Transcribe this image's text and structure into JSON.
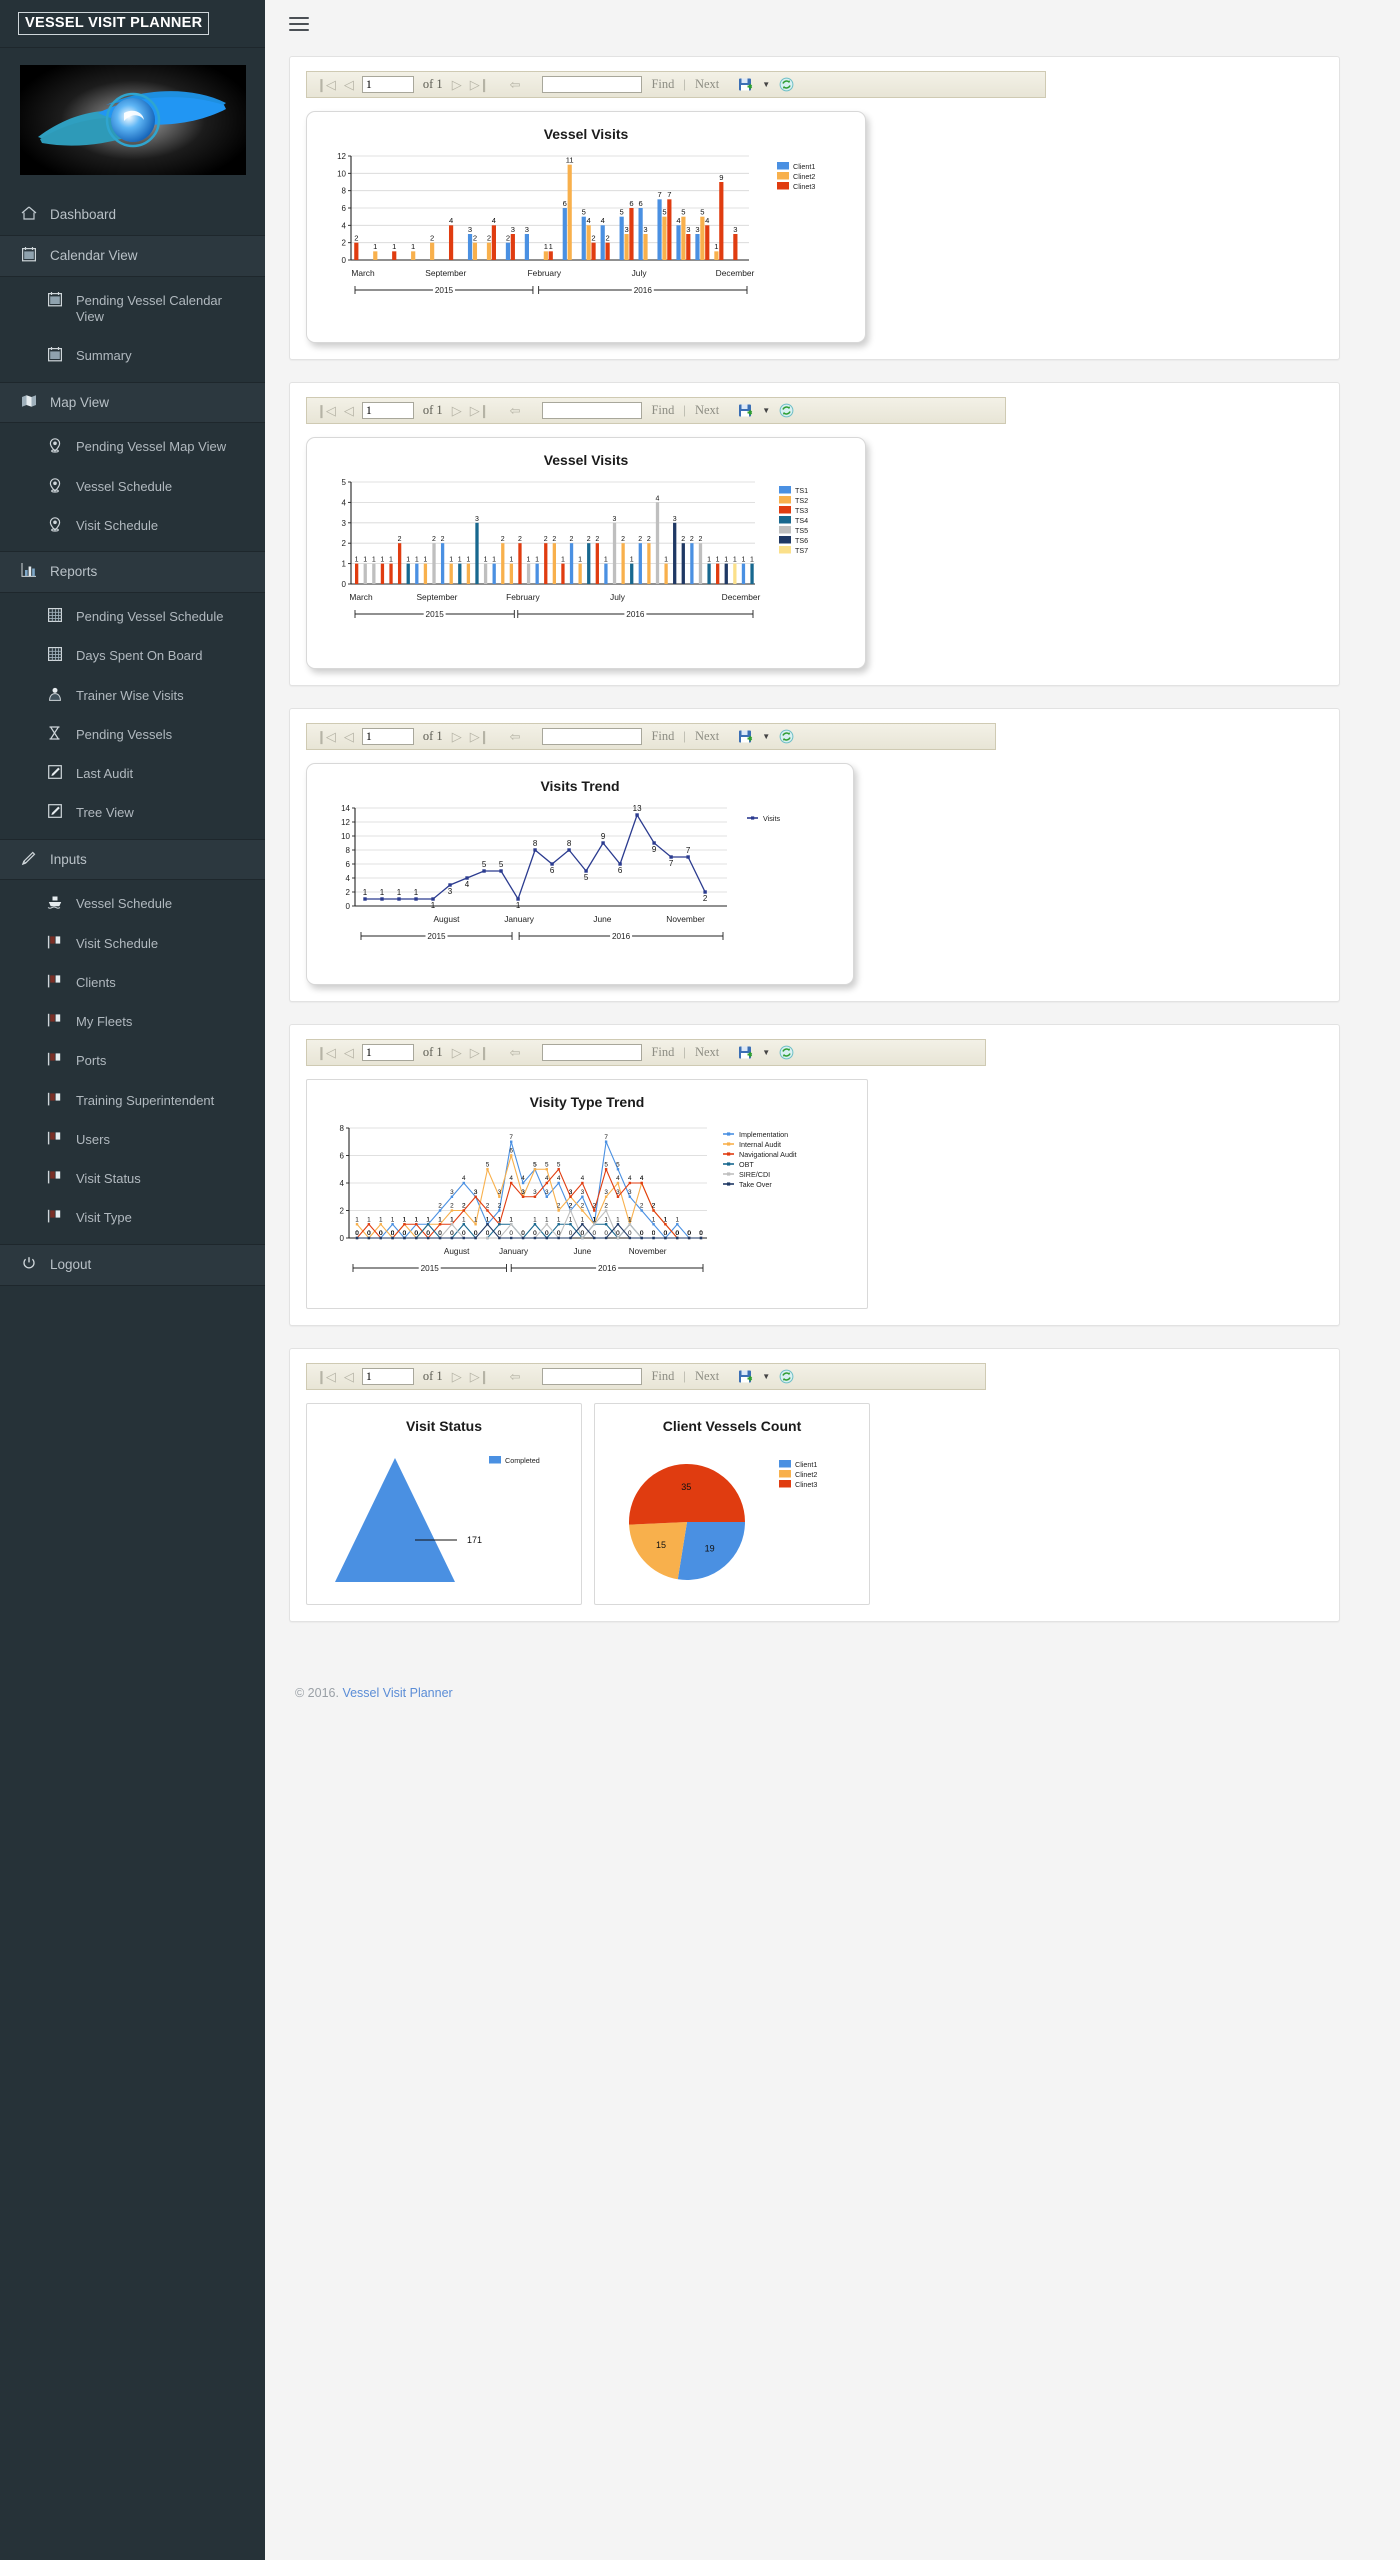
{
  "app": {
    "brand": "VESSEL VISIT PLANNER",
    "logo_alt": "eye-logo",
    "menu_icon": "hamburger-icon"
  },
  "sidebar": {
    "items": [
      {
        "label": "Dashboard",
        "icon": "home-icon",
        "type": "top"
      },
      {
        "label": "Calendar View",
        "icon": "calendar-icon",
        "type": "group"
      },
      {
        "label": "Pending Vessel Calendar View",
        "icon": "calendar-icon",
        "type": "sub"
      },
      {
        "label": "Summary",
        "icon": "calendar-icon",
        "type": "sub"
      },
      {
        "label": "Map View",
        "icon": "map-icon",
        "type": "group"
      },
      {
        "label": "Pending Vessel Map View",
        "icon": "map-pin-icon",
        "type": "sub"
      },
      {
        "label": "Vessel Schedule",
        "icon": "map-pin-icon",
        "type": "sub"
      },
      {
        "label": "Visit Schedule",
        "icon": "map-pin-icon",
        "type": "sub"
      },
      {
        "label": "Reports",
        "icon": "bar-chart-icon",
        "type": "group"
      },
      {
        "label": "Pending Vessel Schedule",
        "icon": "grid-icon",
        "type": "sub"
      },
      {
        "label": "Days Spent On Board",
        "icon": "grid-icon",
        "type": "sub"
      },
      {
        "label": "Trainer Wise Visits",
        "icon": "person-icon",
        "type": "sub"
      },
      {
        "label": "Pending Vessels",
        "icon": "hourglass-icon",
        "type": "sub"
      },
      {
        "label": "Last Audit",
        "icon": "edit-icon",
        "type": "sub"
      },
      {
        "label": "Tree View",
        "icon": "edit-icon",
        "type": "sub"
      },
      {
        "label": "Inputs",
        "icon": "pencil-icon",
        "type": "group"
      },
      {
        "label": "Vessel Schedule",
        "icon": "ship-icon",
        "type": "sub"
      },
      {
        "label": "Visit Schedule",
        "icon": "flag-icon",
        "type": "sub"
      },
      {
        "label": "Clients",
        "icon": "flag-icon",
        "type": "sub"
      },
      {
        "label": "My Fleets",
        "icon": "flag-icon",
        "type": "sub"
      },
      {
        "label": "Ports",
        "icon": "flag-icon",
        "type": "sub"
      },
      {
        "label": "Training Superintendent",
        "icon": "flag-icon",
        "type": "sub"
      },
      {
        "label": "Users",
        "icon": "flag-icon",
        "type": "sub"
      },
      {
        "label": "Visit Status",
        "icon": "flag-icon",
        "type": "sub"
      },
      {
        "label": "Visit Type",
        "icon": "flag-icon",
        "type": "sub"
      },
      {
        "label": "Logout",
        "icon": "power-icon",
        "type": "top"
      }
    ]
  },
  "toolbar": {
    "first_icon": "first-page-icon",
    "prev_icon": "prev-page-icon",
    "page_value": "1",
    "page_placeholder": "",
    "of_label": "of 1",
    "next_icon": "next-page-icon",
    "last_icon": "last-page-icon",
    "back_icon": "back-to-parent-icon",
    "find_value": "",
    "find_placeholder": "",
    "find_label": "Find",
    "separator": "|",
    "next_label": "Next",
    "export_icon": "export-save-icon",
    "caret_icon": "chevron-down-icon",
    "refresh_icon": "refresh-icon"
  },
  "footer": {
    "copyright": "© 2016.",
    "link": "Vessel Visit Planner"
  },
  "chart_data": [
    {
      "id": "vessel-visits-client",
      "type": "bar",
      "title": "Vessel Visits",
      "xlabel": "",
      "ylabel": "",
      "ylim": [
        0,
        12
      ],
      "yticks": [
        0,
        2,
        4,
        6,
        8,
        10,
        12
      ],
      "grid": true,
      "legend_position": "right",
      "legend": [
        "Client1",
        "Clinet2",
        "Clinet3"
      ],
      "colors": [
        "#4a90e2",
        "#f8b04c",
        "#e03c10"
      ],
      "tick_labels": [
        "March",
        "September",
        "February",
        "July",
        "December"
      ],
      "group_axis": [
        {
          "label": "2015",
          "span": "March - December 2015"
        },
        {
          "label": "2016",
          "span": "January - December 2016"
        }
      ],
      "series": [
        {
          "name": "Client1",
          "values": [
            0,
            0,
            0,
            0,
            0,
            0,
            3,
            0,
            2,
            3,
            0,
            6,
            5,
            4,
            5,
            6,
            7,
            4,
            3,
            0,
            0
          ]
        },
        {
          "name": "Clinet2",
          "values": [
            0,
            1,
            0,
            1,
            2,
            0,
            2,
            2,
            0,
            0,
            1,
            11,
            4,
            0,
            3,
            3,
            5,
            5,
            5,
            1,
            0
          ]
        },
        {
          "name": "Clinet3",
          "values": [
            2,
            0,
            1,
            0,
            0,
            4,
            0,
            4,
            3,
            0,
            1,
            0,
            2,
            2,
            6,
            0,
            7,
            3,
            4,
            9,
            3
          ]
        }
      ],
      "data_labels": [
        2,
        1,
        1,
        2,
        1,
        4,
        3,
        2,
        4,
        2,
        2,
        3,
        3,
        5,
        1,
        6,
        11,
        1,
        5,
        4,
        1,
        2,
        4,
        2,
        6,
        3,
        3,
        6,
        5,
        2,
        7,
        7,
        5,
        4,
        3,
        5,
        5,
        4,
        1,
        9,
        3
      ]
    },
    {
      "id": "vessel-visits-ts",
      "type": "bar",
      "title": "Vessel Visits",
      "ylim": [
        0,
        5
      ],
      "yticks": [
        0,
        1,
        2,
        3,
        4,
        5
      ],
      "grid": true,
      "legend_position": "right",
      "legend": [
        "TS1",
        "TS2",
        "TS3",
        "TS4",
        "TS5",
        "TS6",
        "TS7"
      ],
      "colors": [
        "#4a90e2",
        "#f8b04c",
        "#e03c10",
        "#18688f",
        "#bfbfbf",
        "#1f3864",
        "#fbe08a"
      ],
      "tick_labels": [
        "March",
        "September",
        "February",
        "July",
        "December"
      ],
      "group_axis": [
        {
          "label": "2015",
          "span": "March - December 2015"
        },
        {
          "label": "2016",
          "span": "January - December 2016"
        }
      ],
      "bars": [
        {
          "v": 1,
          "c": 2
        },
        {
          "v": 1,
          "c": 4
        },
        {
          "v": 1,
          "c": 4
        },
        {
          "v": 1,
          "c": 2
        },
        {
          "v": 1,
          "c": 2
        },
        {
          "v": 2,
          "c": 2
        },
        {
          "v": 1,
          "c": 3
        },
        {
          "v": 1,
          "c": 0
        },
        {
          "v": 1,
          "c": 1
        },
        {
          "v": 2,
          "c": 4
        },
        {
          "v": 2,
          "c": 0
        },
        {
          "v": 1,
          "c": 1
        },
        {
          "v": 1,
          "c": 3
        },
        {
          "v": 1,
          "c": 1
        },
        {
          "v": 3,
          "c": 3
        },
        {
          "v": 1,
          "c": 4
        },
        {
          "v": 1,
          "c": 0
        },
        {
          "v": 2,
          "c": 1
        },
        {
          "v": 1,
          "c": 1
        },
        {
          "v": 2,
          "c": 2
        },
        {
          "v": 1,
          "c": 4
        },
        {
          "v": 1,
          "c": 0
        },
        {
          "v": 2,
          "c": 2
        },
        {
          "v": 2,
          "c": 1
        },
        {
          "v": 1,
          "c": 2
        },
        {
          "v": 2,
          "c": 0
        },
        {
          "v": 1,
          "c": 1
        },
        {
          "v": 2,
          "c": 3
        },
        {
          "v": 2,
          "c": 2
        },
        {
          "v": 1,
          "c": 0
        },
        {
          "v": 3,
          "c": 4
        },
        {
          "v": 2,
          "c": 1
        },
        {
          "v": 1,
          "c": 3
        },
        {
          "v": 2,
          "c": 0
        },
        {
          "v": 2,
          "c": 1
        },
        {
          "v": 4,
          "c": 4
        },
        {
          "v": 1,
          "c": 1
        },
        {
          "v": 3,
          "c": 5
        },
        {
          "v": 2,
          "c": 5
        },
        {
          "v": 2,
          "c": 0
        },
        {
          "v": 2,
          "c": 4
        },
        {
          "v": 1,
          "c": 3
        },
        {
          "v": 1,
          "c": 2
        },
        {
          "v": 1,
          "c": 5
        },
        {
          "v": 1,
          "c": 6
        },
        {
          "v": 1,
          "c": 0
        },
        {
          "v": 1,
          "c": 3
        }
      ]
    },
    {
      "id": "visits-trend",
      "type": "line",
      "title": "Visits Trend",
      "ylim": [
        0,
        14
      ],
      "yticks": [
        0,
        2,
        4,
        6,
        8,
        10,
        12,
        14
      ],
      "grid": true,
      "legend_position": "right",
      "legend": [
        "Visits"
      ],
      "colors": [
        "#2b3b8f"
      ],
      "tick_labels": [
        "August",
        "January",
        "June",
        "November"
      ],
      "group_axis": [
        {
          "label": "2015",
          "span": "2015"
        },
        {
          "label": "2016",
          "span": "2016"
        }
      ],
      "values": [
        1,
        1,
        1,
        1,
        1,
        3,
        4,
        5,
        5,
        1,
        8,
        6,
        8,
        5,
        9,
        6,
        13,
        9,
        7,
        7,
        2
      ]
    },
    {
      "id": "visit-type-trend",
      "type": "line",
      "title": "Visity Type Trend",
      "ylim": [
        0,
        8
      ],
      "yticks": [
        0,
        2,
        4,
        6,
        8
      ],
      "grid": true,
      "legend_position": "right",
      "legend": [
        "Implementation",
        "Internal Audit",
        "Navigational Audit",
        "OBT",
        "SIRE/CDI",
        "Take Over"
      ],
      "colors": [
        "#4a90e2",
        "#f8b04c",
        "#e03c10",
        "#18688f",
        "#bfbfbf",
        "#1f3864"
      ],
      "tick_labels": [
        "August",
        "January",
        "June",
        "November"
      ],
      "group_axis": [
        {
          "label": "2015",
          "span": "2015"
        },
        {
          "label": "2016",
          "span": "2016"
        }
      ],
      "series": [
        {
          "name": "Implementation",
          "values": [
            0,
            0,
            0,
            1,
            0,
            1,
            1,
            2,
            3,
            4,
            3,
            1,
            2,
            7,
            4,
            5,
            3,
            4,
            2,
            3,
            1,
            7,
            5,
            3,
            2,
            1,
            0,
            1,
            0,
            0
          ]
        },
        {
          "name": "Internal Audit",
          "values": [
            1,
            0,
            1,
            0,
            1,
            0,
            1,
            1,
            2,
            2,
            1,
            5,
            3,
            6,
            3,
            5,
            5,
            2,
            3,
            2,
            1,
            3,
            4,
            1,
            4,
            2,
            1,
            0,
            0,
            0
          ]
        },
        {
          "name": "Navigational Audit",
          "values": [
            0,
            1,
            0,
            0,
            1,
            1,
            0,
            1,
            1,
            2,
            3,
            2,
            1,
            4,
            3,
            3,
            4,
            5,
            3,
            4,
            2,
            5,
            3,
            4,
            4,
            2,
            1,
            0,
            0,
            0
          ]
        },
        {
          "name": "OBT",
          "values": [
            0,
            0,
            0,
            0,
            0,
            0,
            1,
            0,
            0,
            1,
            0,
            0,
            1,
            1,
            0,
            1,
            0,
            1,
            1,
            0,
            1,
            1,
            0,
            1,
            0,
            0,
            0,
            0,
            0,
            0
          ]
        },
        {
          "name": "SIRE/CDI",
          "values": [
            0,
            0,
            0,
            0,
            0,
            0,
            0,
            0,
            1,
            0,
            0,
            0,
            0,
            1,
            0,
            0,
            1,
            0,
            2,
            0,
            1,
            2,
            0,
            1,
            0,
            0,
            0,
            0,
            0,
            0
          ]
        },
        {
          "name": "Take Over",
          "values": [
            0,
            0,
            0,
            0,
            0,
            0,
            0,
            0,
            0,
            0,
            0,
            1,
            0,
            0,
            0,
            0,
            0,
            0,
            0,
            1,
            0,
            0,
            1,
            0,
            0,
            0,
            0,
            0,
            0,
            0
          ]
        }
      ]
    },
    {
      "id": "visit-status",
      "type": "pie",
      "chart_style": "pyramid",
      "title": "Visit Status",
      "legend_position": "right",
      "legend": [
        "Completed"
      ],
      "colors": [
        "#4a90e2"
      ],
      "categories": [
        "Completed"
      ],
      "values": [
        171
      ],
      "labels": [
        "171"
      ]
    },
    {
      "id": "client-vessels-count",
      "type": "pie",
      "title": "Client Vessels Count",
      "legend_position": "right",
      "legend": [
        "Client1",
        "Clinet2",
        "Clinet3"
      ],
      "colors": [
        "#4a90e2",
        "#f8b04c",
        "#e03c10"
      ],
      "categories": [
        "Client1",
        "Clinet2",
        "Clinet3"
      ],
      "values": [
        19,
        15,
        35
      ],
      "labels": [
        "19",
        "15",
        "35"
      ]
    }
  ]
}
